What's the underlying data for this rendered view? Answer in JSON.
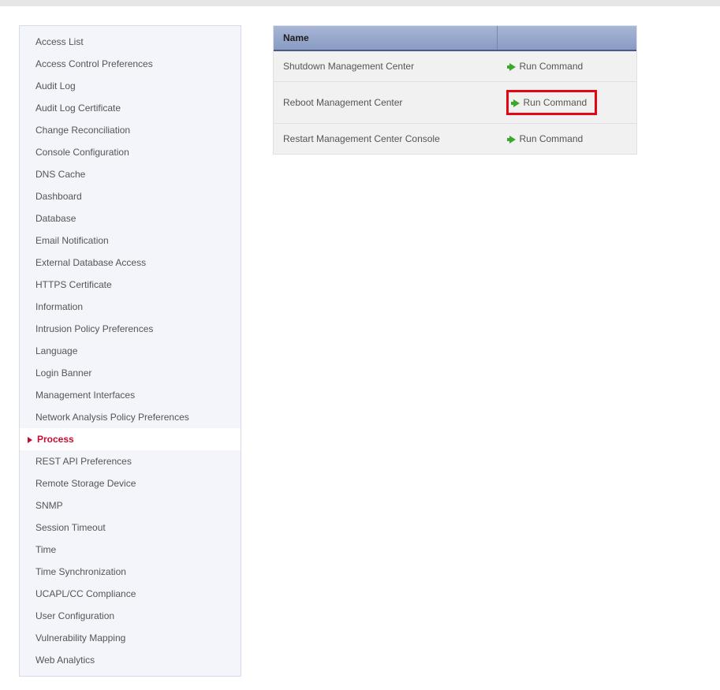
{
  "sidebar": {
    "items": [
      {
        "label": "Access List"
      },
      {
        "label": "Access Control Preferences"
      },
      {
        "label": "Audit Log"
      },
      {
        "label": "Audit Log Certificate"
      },
      {
        "label": "Change Reconciliation"
      },
      {
        "label": "Console Configuration"
      },
      {
        "label": "DNS Cache"
      },
      {
        "label": "Dashboard"
      },
      {
        "label": "Database"
      },
      {
        "label": "Email Notification"
      },
      {
        "label": "External Database Access"
      },
      {
        "label": "HTTPS Certificate"
      },
      {
        "label": "Information"
      },
      {
        "label": "Intrusion Policy Preferences"
      },
      {
        "label": "Language"
      },
      {
        "label": "Login Banner"
      },
      {
        "label": "Management Interfaces"
      },
      {
        "label": "Network Analysis Policy Preferences"
      },
      {
        "label": "Process",
        "active": true
      },
      {
        "label": "REST API Preferences"
      },
      {
        "label": "Remote Storage Device"
      },
      {
        "label": "SNMP"
      },
      {
        "label": "Session Timeout"
      },
      {
        "label": "Time"
      },
      {
        "label": "Time Synchronization"
      },
      {
        "label": "UCAPL/CC Compliance"
      },
      {
        "label": "User Configuration"
      },
      {
        "label": "Vulnerability Mapping"
      },
      {
        "label": "Web Analytics"
      }
    ]
  },
  "table": {
    "header": {
      "name": "Name",
      "action": ""
    },
    "action_label": "Run Command",
    "rows": [
      {
        "name": "Shutdown Management Center",
        "highlight": false
      },
      {
        "name": "Reboot Management Center",
        "highlight": true
      },
      {
        "name": "Restart Management Center Console",
        "highlight": false
      }
    ]
  }
}
